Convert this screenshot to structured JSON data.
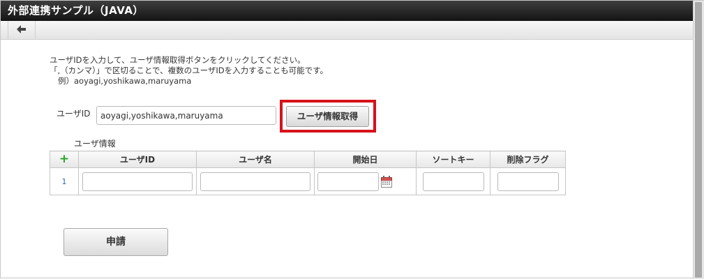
{
  "window": {
    "title": "外部連携サンプル（JAVA）"
  },
  "toolbar": {
    "back_icon": "arrow-left-icon"
  },
  "intro": {
    "line1": "ユーザIDを入力して、ユーザ情報取得ボタンをクリックしてください。",
    "line2": "「,（カンマ）」で区切ることで、複数のユーザIDを入力することも可能です。",
    "line3": "例）aoyagi,yoshikawa,maruyama"
  },
  "form": {
    "user_id_label": "ユーザID",
    "user_id_value": "aoyagi,yoshikawa,maruyama",
    "fetch_button": "ユーザ情報取得",
    "highlight_color": "#d6121a"
  },
  "grid": {
    "section_label": "ユーザ情報",
    "add_icon": "+",
    "headers": [
      "ユーザID",
      "ユーザ名",
      "開始日",
      "ソートキー",
      "削除フラグ"
    ],
    "rows": [
      {
        "num": "1"
      }
    ]
  },
  "submit": {
    "label": "申請"
  }
}
